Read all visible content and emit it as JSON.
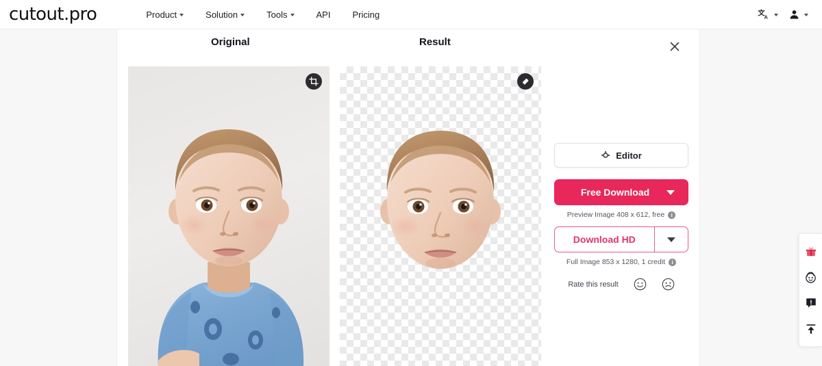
{
  "navbar": {
    "logo": "cutout.pro",
    "links": [
      {
        "label": "Product",
        "has_caret": true
      },
      {
        "label": "Solution",
        "has_caret": true
      },
      {
        "label": "Tools",
        "has_caret": true
      },
      {
        "label": "API",
        "has_caret": false
      },
      {
        "label": "Pricing",
        "has_caret": false
      }
    ],
    "language_icon": "translate-icon",
    "account_icon": "user-icon"
  },
  "workspace": {
    "original_label": "Original",
    "result_label": "Result",
    "close_icon": "close-icon",
    "original_badge_icon": "crop-icon",
    "result_badge_icon": "eraser-icon"
  },
  "actions": {
    "editor_label": "Editor",
    "editor_icon": "magic-wand-icon",
    "free_download_label": "Free Download",
    "preview_meta": "Preview Image 408 x 612, free",
    "download_hd_label": "Download HD",
    "full_meta": "Full Image 853 x 1280, 1 credit",
    "info_glyph": "i",
    "rate_label": "Rate this result",
    "rate_good_icon": "smiley-happy-icon",
    "rate_bad_icon": "smiley-sad-icon"
  },
  "rail": {
    "items": [
      {
        "icon": "gift-icon"
      },
      {
        "icon": "support-face-icon"
      },
      {
        "icon": "feedback-icon"
      },
      {
        "icon": "upload-icon"
      }
    ]
  },
  "colors": {
    "accent": "#e8275a",
    "accent_outline": "#e8588a",
    "page_bg": "#f7f7f7",
    "card_bg": "#ffffff"
  }
}
